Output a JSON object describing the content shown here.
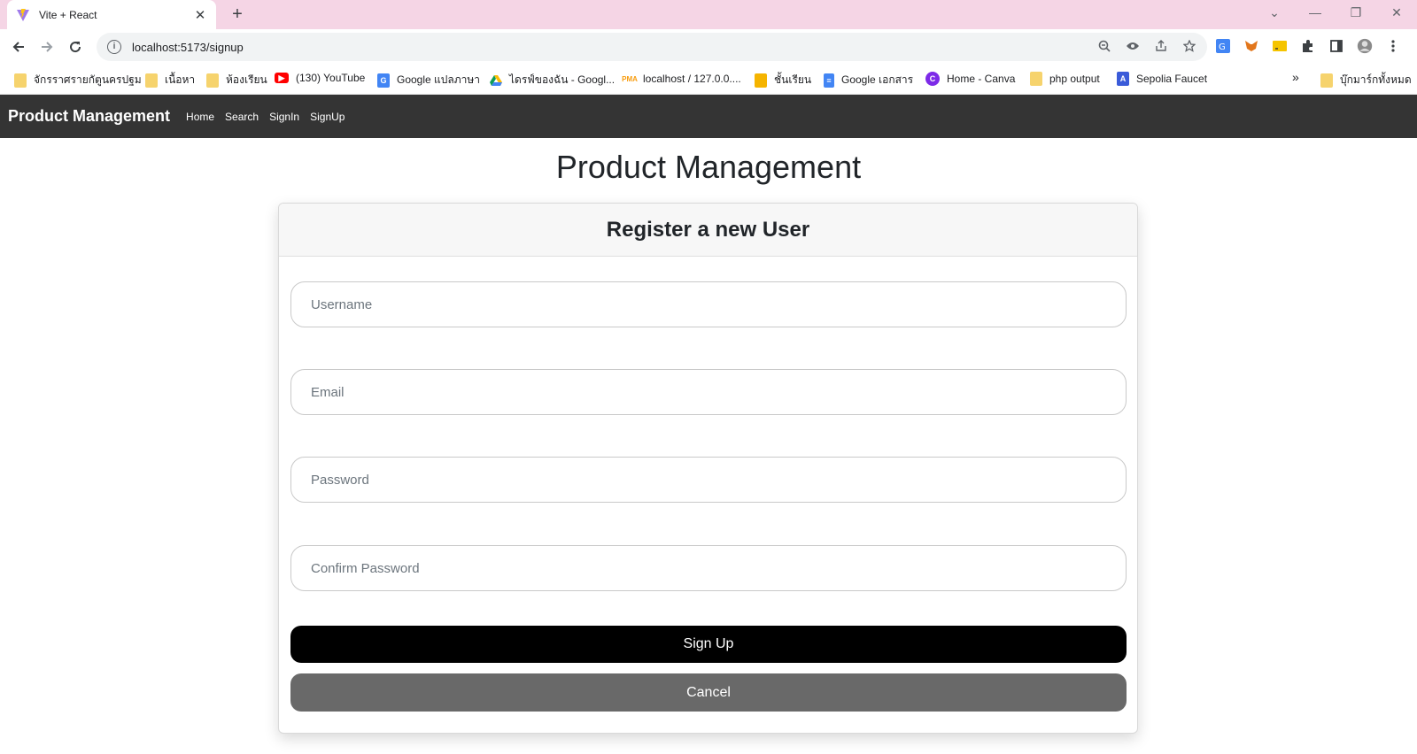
{
  "browser": {
    "tab_title": "Vite + React",
    "tab_close": "✕",
    "new_tab": "+",
    "url": "localhost:5173/signup",
    "window_controls": [
      "⌄",
      "—",
      "❐",
      "✕"
    ],
    "bookmarks": [
      {
        "label": "จักรราศรายกัตูนครปฐม",
        "icon": "folder-icon"
      },
      {
        "label": "เนื้อหา",
        "icon": "folder-icon"
      },
      {
        "label": "ห้องเรียน",
        "icon": "folder-icon"
      },
      {
        "label": "(130) YouTube",
        "icon": "youtube-icon"
      },
      {
        "label": "Google แปลภาษา",
        "icon": "translate-icon"
      },
      {
        "label": "ไดรฟ์ของฉัน - Googl...",
        "icon": "drive-icon"
      },
      {
        "label": "localhost / 127.0.0....",
        "icon": "phpmyadmin-icon"
      },
      {
        "label": "ชั้นเรียน",
        "icon": "classroom-icon"
      },
      {
        "label": "Google เอกสาร",
        "icon": "docs-icon"
      },
      {
        "label": "Home - Canva",
        "icon": "canva-icon"
      },
      {
        "label": "php output",
        "icon": "folder-icon"
      },
      {
        "label": "Sepolia Faucet",
        "icon": "alchemy-icon"
      }
    ],
    "bookmarks_more": "»",
    "all_bookmarks": "บุ๊กมาร์กทั้งหมด"
  },
  "navbar": {
    "brand": "Product Management",
    "links": [
      "Home",
      "Search",
      "SignIn",
      "SignUp"
    ]
  },
  "page": {
    "title": "Product Management",
    "card_title": "Register a new User",
    "fields": {
      "username": {
        "placeholder": "Username",
        "value": ""
      },
      "email": {
        "placeholder": "Email",
        "value": ""
      },
      "password": {
        "placeholder": "Password",
        "value": ""
      },
      "confirm_password": {
        "placeholder": "Confirm Password",
        "value": ""
      }
    },
    "signup_label": "Sign Up",
    "cancel_label": "Cancel"
  },
  "colors": {
    "tabbar_bg": "#f5d5e5",
    "navbar_bg": "#343434",
    "signup_bg": "#000000",
    "cancel_bg": "#696969"
  }
}
